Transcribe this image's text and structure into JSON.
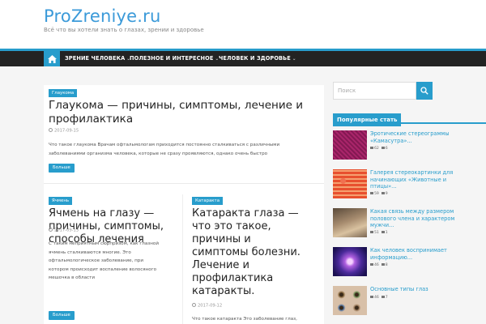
{
  "site": {
    "title": "ProZreniye.ru",
    "description": "Всё что вы хотели знать о глазах, зрении и здоровье"
  },
  "nav": {
    "home_icon": "home-icon",
    "items": [
      {
        "label": "ЗРЕНИЕ ЧЕЛОВЕКА"
      },
      {
        "label": "ПОЛЕЗНОЕ И ИНТЕРЕСНОЕ"
      },
      {
        "label": "ЧЕЛОВЕК И ЗДОРОВЬЕ"
      }
    ],
    "chevron": "⌄"
  },
  "posts": [
    {
      "category": "Глаукома",
      "title_lines": [
        "Глаукома — причины, симптомы, лечение и",
        "профилактика"
      ],
      "date": "2017-09-15",
      "excerpt_lines": [
        "Что такое глаукома Врачам офтальмологам приходится постоянно сталкиваться с различными",
        "заболеваниями организма человека, которые не сразу проявляются, однако очень быстро"
      ],
      "more": "Больше"
    },
    {
      "category": "Ячмень",
      "title_lines": [
        "Ячмень на глазу —",
        "причины, симптомы,",
        "способы лечения"
      ],
      "date": "2017-09-13",
      "excerpt_lines": [
        "С таким неприятным сюрпризом, как глазной",
        "ячмень сталкиваются многие. Это",
        "офтальмологическое заболевание, при",
        "котором происходит воспаление волосяного",
        "мешочка в области"
      ],
      "more": "Больше"
    },
    {
      "category": "Катаракта",
      "title_lines": [
        "Катаракта глаза —",
        "что это такое,",
        "причины и",
        "симптомы болезни.",
        "Лечение и",
        "профилактика",
        "катаракты."
      ],
      "date": "2017-09-12",
      "excerpt_lines": [
        "Что такое катаракта Это заболевание глаз,"
      ]
    }
  ],
  "sidebar": {
    "search_placeholder": "Поиск",
    "popular_title": "Популярные стать",
    "popular": [
      {
        "lines": [
          "Эротические стереограммы",
          "«Камасутра»..."
        ],
        "views": "62",
        "comments": "6"
      },
      {
        "lines": [
          "Галерея стереокартинки для",
          "начинающих «Животные и",
          "птицы»..."
        ],
        "views": "59",
        "comments": "9"
      },
      {
        "lines": [
          "Какая связь между размером",
          "полового члена и характером",
          "мужчи..."
        ],
        "views": "51",
        "comments": "1"
      },
      {
        "lines": [
          "Как человек воспринимает",
          "информацию..."
        ],
        "views": "46",
        "comments": "8"
      },
      {
        "lines": [
          "Основные типы глаз"
        ],
        "views": "46",
        "comments": "7"
      }
    ]
  },
  "colors": {
    "accent": "#289dcc",
    "nav_bg": "#232323",
    "title": "#3b9ad9"
  }
}
